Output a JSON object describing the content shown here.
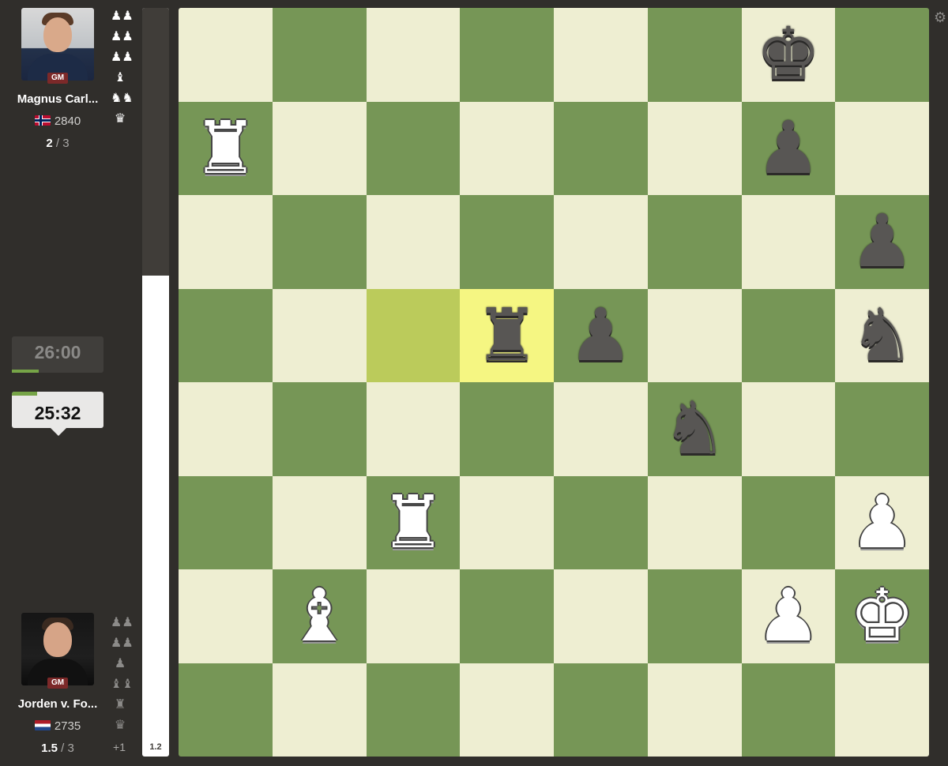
{
  "players": {
    "top": {
      "name": "Magnus Carl...",
      "title": "GM",
      "rating": "2840",
      "score": "2",
      "score_total": "/ 3",
      "captured": [
        "♟♟",
        "♟♟",
        "♟♟",
        "♝",
        "♞♞",
        "♛"
      ]
    },
    "bottom": {
      "name": "Jorden v. Fo...",
      "title": "GM",
      "rating": "2735",
      "score": "1.5",
      "score_total": "/ 3",
      "captured": [
        "♟♟",
        "♟♟",
        "♟",
        "♝♝",
        "♜",
        "♛"
      ],
      "advantage": "+1"
    }
  },
  "clocks": {
    "top": "26:00",
    "bottom": "25:32"
  },
  "eval": {
    "value": "1.2",
    "white_fraction": 0.642
  },
  "board": {
    "colors": {
      "light": "#eeeed2",
      "dark": "#769656",
      "highlight_from": "#bbcb5b",
      "highlight_to": "#f5f682"
    },
    "highlight": {
      "from": "c5",
      "to": "d5"
    },
    "ranks": [
      [
        "",
        "",
        "",
        "",
        "",
        "",
        "bK",
        ""
      ],
      [
        "wR",
        "",
        "",
        "",
        "",
        "",
        "bP",
        ""
      ],
      [
        "",
        "",
        "",
        "",
        "",
        "",
        "",
        "bP"
      ],
      [
        "",
        "",
        "",
        "bR",
        "bP",
        "",
        "",
        "bN"
      ],
      [
        "",
        "",
        "",
        "",
        "",
        "bN",
        "",
        ""
      ],
      [
        "",
        "",
        "wR",
        "",
        "",
        "",
        "",
        "wP"
      ],
      [
        "",
        "wB",
        "",
        "",
        "",
        "",
        "wP",
        "wK"
      ],
      [
        "",
        "",
        "",
        "",
        "",
        "",
        "",
        ""
      ]
    ]
  }
}
